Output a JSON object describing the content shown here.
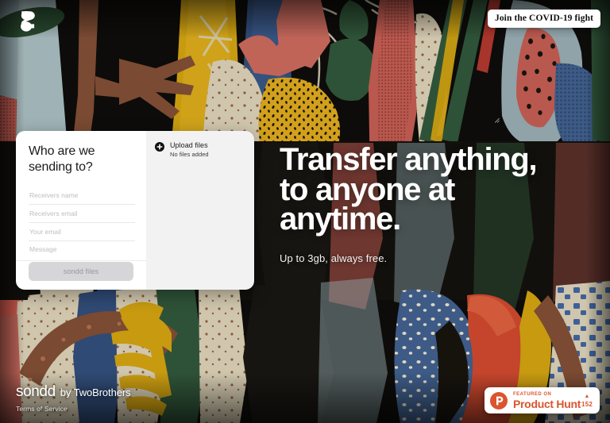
{
  "brand": {
    "logo_icon": "sondd-s-mark-icon",
    "name": "sondd",
    "by": "by TwoBrothers",
    "terms_label": "Terms of Service"
  },
  "covid_banner": {
    "label": "Join the COVID-19 fight"
  },
  "hero": {
    "headline": "Transfer anything, to anyone at anytime.",
    "subtitle": "Up to 3gb, always free."
  },
  "transfer_card": {
    "title": "Who are we sending to?",
    "fields": [
      {
        "name": "receivers-name",
        "placeholder": "Receivers name",
        "value": ""
      },
      {
        "name": "receivers-email",
        "placeholder": "Receivers email",
        "value": ""
      },
      {
        "name": "your-email",
        "placeholder": "Your email",
        "value": ""
      }
    ],
    "message": {
      "placeholder": "Message",
      "value": ""
    },
    "submit_label": "sondd files",
    "upload": {
      "plus_icon": "plus-circle-icon",
      "title": "Upload files",
      "subtitle": "No files added"
    }
  },
  "product_hunt": {
    "logo_icon": "product-hunt-p-icon",
    "featured_label": "FEATURED ON",
    "name": "Product Hunt",
    "arrow_icon": "upvote-triangle-icon",
    "count": "152"
  },
  "colors": {
    "page_background": "#0d0c0a",
    "card_background": "#ffffff",
    "upload_background": "#f2f2f2",
    "submit_disabled": "#d6d6d8",
    "product_hunt_orange": "#da552f",
    "hero_text": "#ffffff"
  }
}
